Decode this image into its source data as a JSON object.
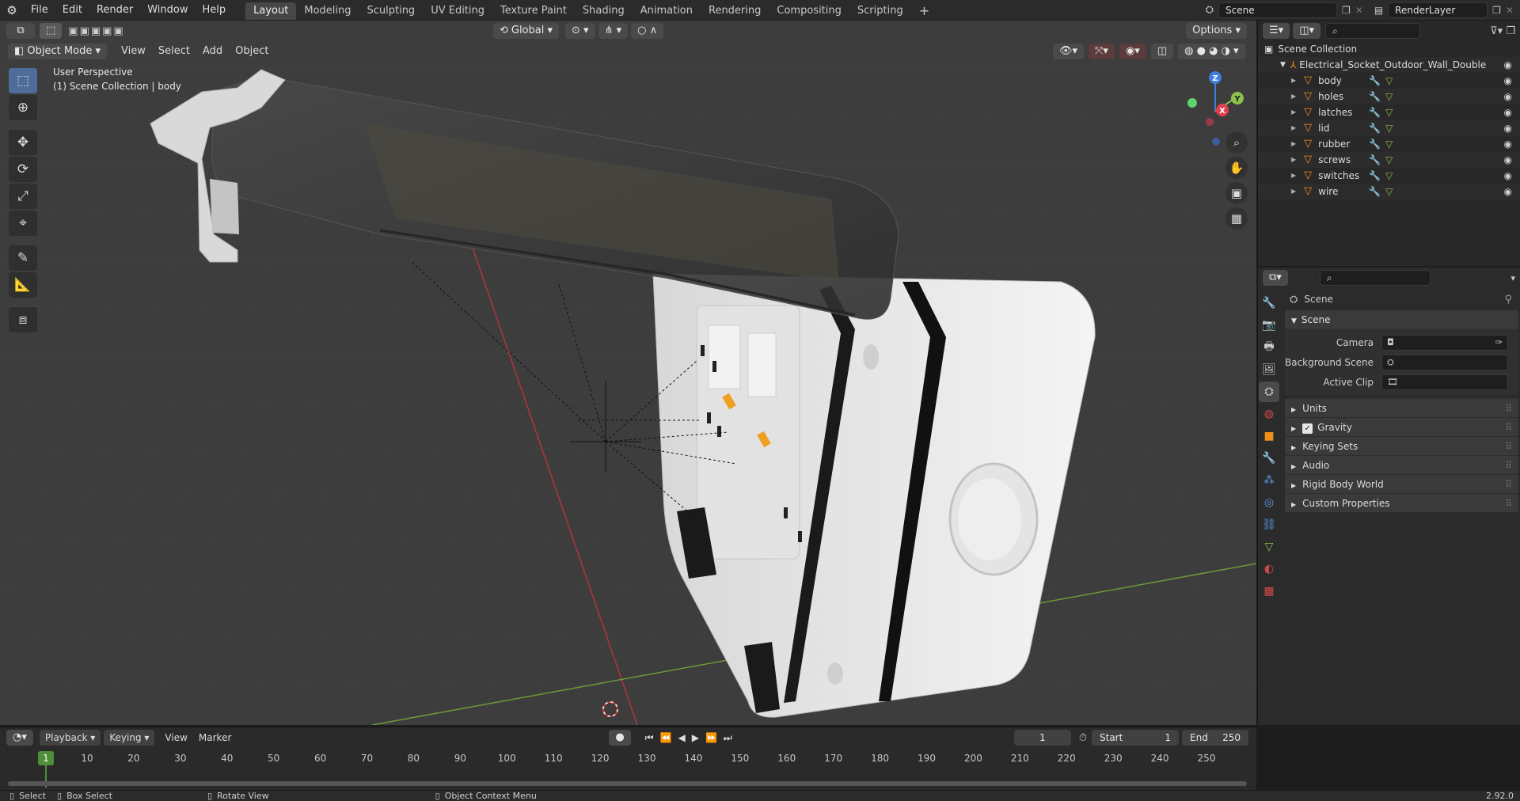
{
  "menu": [
    "File",
    "Edit",
    "Render",
    "Window",
    "Help"
  ],
  "workspaces": [
    "Layout",
    "Modeling",
    "Sculpting",
    "UV Editing",
    "Texture Paint",
    "Shading",
    "Animation",
    "Rendering",
    "Compositing",
    "Scripting"
  ],
  "active_workspace": "Layout",
  "scene_name": "Scene",
  "view_layer": "RenderLayer",
  "viewport": {
    "mode": "Object Mode",
    "menus": [
      "View",
      "Select",
      "Add",
      "Object"
    ],
    "transform_orientation": "Global",
    "options_label": "Options",
    "overlay_title": "User Perspective",
    "overlay_sub": "(1) Scene Collection | body",
    "gizmo_axes": {
      "x": "X",
      "y": "Y",
      "z": "Z"
    }
  },
  "outliner": {
    "root": "Scene Collection",
    "collection": "Electrical_Socket_Outdoor_Wall_Double",
    "objects": [
      "body",
      "holes",
      "latches",
      "lid",
      "rubber",
      "screws",
      "switches",
      "wire"
    ]
  },
  "properties": {
    "context_label": "Scene",
    "panel_title": "Scene",
    "fields": [
      {
        "label": "Camera"
      },
      {
        "label": "Background Scene"
      },
      {
        "label": "Active Clip"
      }
    ],
    "subpanels": [
      "Units",
      "Gravity",
      "Keying Sets",
      "Audio",
      "Rigid Body World",
      "Custom Properties"
    ],
    "gravity_checked": true
  },
  "timeline": {
    "menus": [
      "Playback",
      "Keying",
      "View",
      "Marker"
    ],
    "current_frame": "1",
    "start_label": "Start",
    "start": "1",
    "end_label": "End",
    "end": "250",
    "ruler": [
      "1",
      "10",
      "20",
      "30",
      "40",
      "50",
      "60",
      "70",
      "80",
      "90",
      "100",
      "110",
      "120",
      "130",
      "140",
      "150",
      "160",
      "170",
      "180",
      "190",
      "200",
      "210",
      "220",
      "230",
      "240",
      "250"
    ]
  },
  "statusbar": {
    "select": "Select",
    "box_select": "Box Select",
    "rotate": "Rotate View",
    "context_menu": "Object Context Menu",
    "version": "2.92.0"
  },
  "colors": {
    "accent_blue": "#4f6d9b",
    "object_orange": "#f0901c",
    "viewport_bg": "#3d3d3d",
    "x_axis": "#e0404f",
    "y_axis": "#8bc34a",
    "z_axis": "#3f7fe0"
  }
}
